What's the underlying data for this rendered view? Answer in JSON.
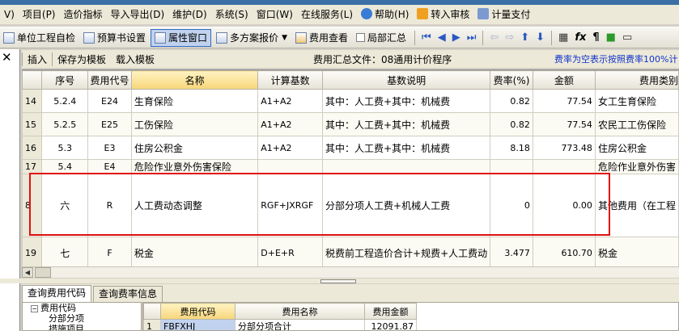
{
  "menu": [
    {
      "label": "V)",
      "icon": ""
    },
    {
      "label": "项目(P)",
      "icon": ""
    },
    {
      "label": "造价指标",
      "icon": ""
    },
    {
      "label": "导入导出(D)",
      "icon": ""
    },
    {
      "label": "维护(D)",
      "icon": ""
    },
    {
      "label": "系统(S)",
      "icon": ""
    },
    {
      "label": "窗口(W)",
      "icon": ""
    },
    {
      "label": "在线服务(L)",
      "icon": ""
    },
    {
      "label": "帮助(H)",
      "icon": "help-icon"
    },
    {
      "label": "转入审核",
      "icon": "audit-icon"
    },
    {
      "label": "计量支付",
      "icon": "payment-icon"
    }
  ],
  "toolbar": {
    "unit_check": "单位工程自检",
    "budget_settings": "预算书设置",
    "property_window": "属性窗口",
    "multi_quote": "多方案报价",
    "fee_view": "费用查看",
    "partial_summary": "局部汇总"
  },
  "subbar": {
    "insert": "插入",
    "save_template": "保存为模板",
    "load_template": "载入模板",
    "file_label": "费用汇总文件：08通用计价程序",
    "note": "费率为空表示按照费率100%计"
  },
  "grid": {
    "headers": [
      "",
      "序号",
      "费用代号",
      "名称",
      "计算基数",
      "基数说明",
      "费率(%)",
      "金额",
      "费用类别"
    ],
    "rows": [
      {
        "num": "14",
        "seq": "5.2.4",
        "code": "E24",
        "name": "生育保险",
        "base": "A1+A2",
        "desc": "其中：人工费+其中：机械费",
        "rate": "0.82",
        "amount": "77.54",
        "category": "女工生育保险"
      },
      {
        "num": "15",
        "seq": "5.2.5",
        "code": "E25",
        "name": "工伤保险",
        "base": "A1+A2",
        "desc": "其中：人工费+其中：机械费",
        "rate": "0.82",
        "amount": "77.54",
        "category": "农民工工伤保险"
      },
      {
        "num": "16",
        "seq": "5.3",
        "code": "E3",
        "name": "住房公积金",
        "base": "A1+A2",
        "desc": "其中：人工费+其中：机械费",
        "rate": "8.18",
        "amount": "773.48",
        "category": "住房公积金"
      },
      {
        "num": "17",
        "seq": "5.4",
        "code": "E4",
        "name": "危险作业意外伤害保险",
        "base": "",
        "desc": "",
        "rate": "",
        "amount": "",
        "category": "危险作业意外伤害"
      },
      {
        "num": "8",
        "seq": "六",
        "code": "R",
        "name": "人工费动态调整",
        "base": "RGF+JXRGF",
        "desc": "分部分项人工费+机械人工费",
        "rate": "0",
        "amount": "0.00",
        "category": "其他费用（在工程"
      },
      {
        "num": "19",
        "seq": "七",
        "code": "F",
        "name": "税金",
        "base": "D+E+R",
        "desc": "税费前工程造价合计+规费+人工费动",
        "rate": "3.477",
        "amount": "610.70",
        "category": "税金"
      }
    ]
  },
  "bottom": {
    "tabs": [
      "查询费用代码",
      "查询费率信息"
    ],
    "tree": [
      "费用代码",
      "分部分项",
      "措施项目"
    ],
    "table_headers": [
      "",
      "费用代码",
      "费用名称",
      "费用金额"
    ],
    "table_rows": [
      {
        "num": "1",
        "code": "FBFXHJ",
        "name": "分部分项合计",
        "amount": "12091.87"
      }
    ]
  },
  "colors": {
    "highlight_box": "#e01010",
    "note_text": "#1033cc"
  }
}
